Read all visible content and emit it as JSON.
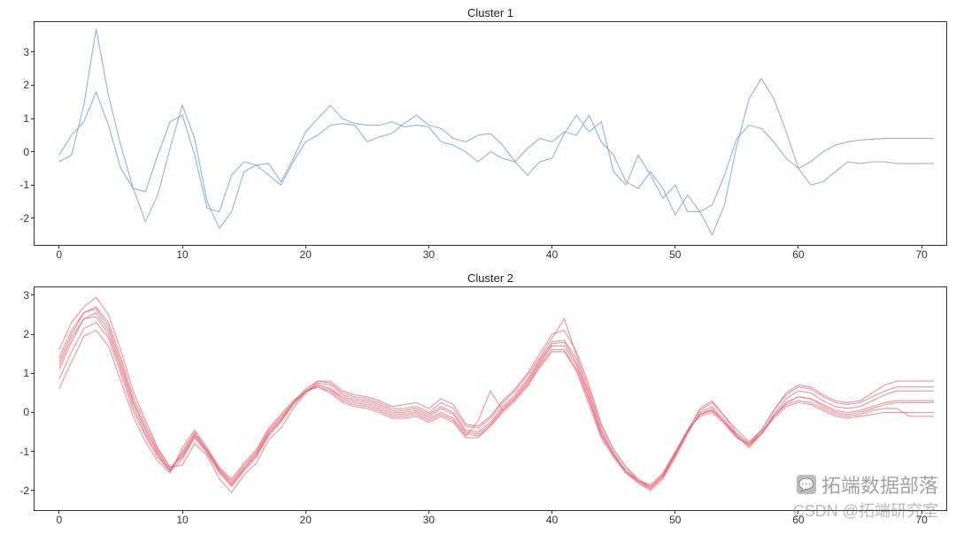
{
  "watermarks": {
    "line1_icon": "💬",
    "line1_text": "拓端数据部落",
    "line2": "CSDN @拓端研究室"
  },
  "chart_data": [
    {
      "type": "line",
      "title": "Cluster 1",
      "xlabel": "",
      "ylabel": "",
      "xlim": [
        -2,
        72
      ],
      "ylim": [
        -2.8,
        3.9
      ],
      "xticks": [
        0,
        10,
        20,
        30,
        40,
        50,
        60,
        70
      ],
      "yticks": [
        -2,
        -1,
        0,
        1,
        2,
        3
      ],
      "color": "#7aa6e0",
      "alpha": 0.85,
      "series": [
        {
          "name": "c1-a",
          "values": [
            -0.3,
            -0.1,
            1.4,
            3.7,
            1.7,
            0.2,
            -1.1,
            -2.1,
            -1.3,
            0.1,
            1.4,
            0.4,
            -1.5,
            -2.3,
            -1.8,
            -0.6,
            -0.4,
            -0.35,
            -0.9,
            -0.2,
            0.6,
            1.0,
            1.4,
            1.0,
            0.85,
            0.8,
            0.8,
            0.9,
            0.75,
            0.8,
            0.75,
            0.3,
            0.2,
            0.0,
            -0.3,
            0.0,
            -0.2,
            -0.3,
            -0.7,
            -0.3,
            -0.2,
            0.55,
            1.1,
            0.6,
            0.9,
            -0.6,
            -1.0,
            -0.1,
            -0.7,
            -1.4,
            -1.0,
            -1.8,
            -1.8,
            -2.5,
            -1.6,
            0.2,
            1.6,
            2.2,
            1.6,
            0.6,
            -0.5,
            -1.0,
            -0.9,
            -0.6,
            -0.3,
            -0.35,
            -0.3,
            -0.3,
            -0.35,
            -0.35,
            -0.35,
            -0.35
          ]
        },
        {
          "name": "c1-b",
          "values": [
            -0.1,
            0.5,
            0.9,
            1.8,
            0.8,
            -0.5,
            -1.1,
            -1.2,
            -0.1,
            0.9,
            1.1,
            -0.1,
            -1.7,
            -1.8,
            -0.7,
            -0.3,
            -0.4,
            -0.7,
            -1.0,
            -0.3,
            0.3,
            0.5,
            0.8,
            0.85,
            0.8,
            0.3,
            0.45,
            0.55,
            0.85,
            1.1,
            0.8,
            0.7,
            0.4,
            0.3,
            0.5,
            0.55,
            0.2,
            -0.3,
            0.1,
            0.4,
            0.3,
            0.6,
            0.5,
            1.1,
            0.3,
            -0.1,
            -0.9,
            -1.1,
            -0.6,
            -1.1,
            -1.9,
            -1.3,
            -1.8,
            -1.6,
            -0.7,
            0.4,
            0.8,
            0.7,
            0.3,
            -0.2,
            -0.5,
            -0.3,
            0.0,
            0.2,
            0.3,
            0.35,
            0.38,
            0.4,
            0.4,
            0.4,
            0.4,
            0.4
          ]
        }
      ]
    },
    {
      "type": "line",
      "title": "Cluster 2",
      "xlabel": "",
      "ylabel": "",
      "xlim": [
        -2,
        72
      ],
      "ylim": [
        -2.5,
        3.2
      ],
      "xticks": [
        0,
        10,
        20,
        30,
        40,
        50,
        60,
        70
      ],
      "yticks": [
        -2,
        -1,
        0,
        1,
        2,
        3
      ],
      "color": "#e66b76",
      "alpha": 0.72,
      "series": [
        {
          "name": "c2-a",
          "values": [
            1.6,
            2.3,
            2.7,
            2.95,
            2.5,
            1.6,
            0.55,
            -0.2,
            -0.9,
            -1.4,
            -1.35,
            -0.8,
            -1.1,
            -1.7,
            -2.05,
            -1.6,
            -1.3,
            -0.7,
            -0.4,
            0.1,
            0.5,
            0.8,
            0.8,
            0.55,
            0.45,
            0.4,
            0.3,
            0.15,
            0.2,
            0.25,
            0.1,
            0.35,
            0.2,
            -0.3,
            -0.35,
            -0.1,
            0.3,
            0.6,
            1.0,
            1.5,
            2.0,
            2.1,
            1.55,
            0.7,
            -0.3,
            -0.95,
            -1.4,
            -1.75,
            -1.95,
            -1.65,
            -1.1,
            -0.5,
            0.1,
            0.3,
            -0.1,
            -0.55,
            -0.8,
            -0.45,
            0.05,
            0.5,
            0.7,
            0.65,
            0.45,
            0.3,
            0.25,
            0.3,
            0.5,
            0.7,
            0.8,
            0.8,
            0.8,
            0.8
          ]
        },
        {
          "name": "c2-b",
          "values": [
            1.3,
            2.0,
            2.55,
            2.65,
            2.2,
            1.3,
            0.3,
            -0.4,
            -1.0,
            -1.5,
            -1.2,
            -0.65,
            -1.05,
            -1.55,
            -1.9,
            -1.5,
            -1.15,
            -0.6,
            -0.25,
            0.2,
            0.55,
            0.75,
            0.7,
            0.45,
            0.35,
            0.3,
            0.2,
            0.05,
            0.05,
            0.1,
            -0.05,
            0.15,
            0.0,
            -0.45,
            -0.5,
            -0.25,
            0.15,
            0.45,
            0.85,
            1.35,
            1.8,
            1.85,
            1.35,
            0.5,
            -0.45,
            -1.05,
            -1.5,
            -1.8,
            -2.0,
            -1.7,
            -1.15,
            -0.55,
            0.0,
            0.15,
            -0.2,
            -0.6,
            -0.9,
            -0.55,
            -0.05,
            0.35,
            0.55,
            0.5,
            0.3,
            0.15,
            0.1,
            0.15,
            0.3,
            0.45,
            0.55,
            0.55,
            0.55,
            0.55
          ]
        },
        {
          "name": "c2-c",
          "values": [
            1.1,
            1.8,
            2.4,
            2.45,
            2.0,
            1.1,
            0.15,
            -0.55,
            -1.1,
            -1.5,
            -1.05,
            -0.55,
            -0.95,
            -1.45,
            -1.8,
            -1.4,
            -1.05,
            -0.5,
            -0.15,
            0.25,
            0.55,
            0.7,
            0.6,
            0.35,
            0.25,
            0.2,
            0.1,
            -0.05,
            -0.05,
            0.0,
            -0.15,
            0.0,
            -0.15,
            -0.55,
            -0.6,
            -0.35,
            0.05,
            0.35,
            0.75,
            1.25,
            1.7,
            1.7,
            1.2,
            0.35,
            -0.55,
            -1.1,
            -1.55,
            -1.8,
            -1.95,
            -1.65,
            -1.1,
            -0.5,
            -0.05,
            0.05,
            -0.25,
            -0.65,
            -0.85,
            -0.55,
            -0.1,
            0.25,
            0.4,
            0.35,
            0.15,
            0.0,
            -0.05,
            0.0,
            0.1,
            0.2,
            0.25,
            0.25,
            0.25,
            0.25
          ]
        },
        {
          "name": "c2-d",
          "values": [
            0.6,
            1.3,
            1.95,
            2.1,
            1.7,
            0.8,
            -0.1,
            -0.75,
            -1.25,
            -1.55,
            -0.9,
            -0.45,
            -0.9,
            -1.4,
            -1.7,
            -1.3,
            -0.95,
            -0.4,
            -0.05,
            0.3,
            0.55,
            0.65,
            0.5,
            0.25,
            0.15,
            0.1,
            0.0,
            -0.15,
            -0.15,
            -0.1,
            -0.25,
            -0.1,
            -0.25,
            -0.65,
            -0.65,
            -0.35,
            0.0,
            0.3,
            0.65,
            1.15,
            1.55,
            1.55,
            1.05,
            0.2,
            -0.65,
            -1.15,
            -1.55,
            -1.75,
            -1.85,
            -1.55,
            -1.0,
            -0.45,
            -0.1,
            0.0,
            -0.3,
            -0.65,
            -0.8,
            -0.55,
            -0.15,
            0.15,
            0.25,
            0.2,
            0.05,
            -0.1,
            -0.15,
            -0.1,
            -0.05,
            0.0,
            0.0,
            0.0,
            0.0,
            0.0
          ]
        },
        {
          "name": "c2-e",
          "values": [
            1.4,
            2.1,
            2.55,
            2.7,
            2.3,
            1.4,
            0.4,
            -0.3,
            -0.95,
            -1.4,
            -1.15,
            -0.6,
            -1.0,
            -1.5,
            -1.85,
            -1.45,
            -1.1,
            -0.55,
            -0.2,
            0.25,
            0.6,
            0.8,
            0.75,
            0.5,
            0.4,
            0.35,
            0.25,
            0.1,
            0.1,
            0.15,
            0.0,
            0.25,
            0.1,
            -0.35,
            -0.4,
            -0.15,
            0.25,
            0.55,
            0.95,
            1.4,
            1.9,
            2.4,
            1.45,
            0.6,
            -0.35,
            -0.95,
            -1.4,
            -1.7,
            -1.9,
            -1.6,
            -1.05,
            -0.45,
            0.05,
            0.25,
            -0.1,
            -0.45,
            -0.75,
            -0.45,
            0.05,
            0.45,
            0.65,
            0.6,
            0.4,
            0.25,
            0.2,
            0.25,
            0.4,
            0.55,
            0.65,
            0.65,
            0.65,
            0.65
          ]
        },
        {
          "name": "c2-f",
          "values": [
            1.2,
            1.9,
            2.4,
            2.55,
            2.1,
            1.2,
            0.25,
            -0.45,
            -1.05,
            -1.45,
            -1.1,
            -0.6,
            -1.0,
            -1.5,
            -1.85,
            -1.45,
            -1.1,
            -0.55,
            -0.2,
            0.2,
            0.5,
            0.7,
            0.6,
            0.4,
            0.3,
            0.25,
            0.15,
            0.0,
            0.0,
            0.05,
            -0.1,
            0.1,
            -0.05,
            -0.5,
            -0.55,
            -0.3,
            0.1,
            0.4,
            0.8,
            1.3,
            1.75,
            1.8,
            1.25,
            0.45,
            -0.5,
            -1.05,
            -1.5,
            -1.75,
            -1.9,
            -1.6,
            -1.05,
            -0.5,
            -0.05,
            0.1,
            -0.25,
            -0.6,
            -0.85,
            -0.55,
            -0.1,
            0.25,
            0.4,
            0.35,
            0.2,
            0.05,
            0.0,
            0.05,
            0.15,
            0.25,
            0.3,
            0.3,
            0.3,
            0.3
          ]
        },
        {
          "name": "c2-g",
          "values": [
            0.85,
            1.55,
            2.15,
            2.3,
            1.9,
            1.0,
            0.05,
            -0.6,
            -1.15,
            -1.5,
            -1.0,
            -0.5,
            -0.95,
            -1.45,
            -1.75,
            -1.35,
            -1.0,
            -0.45,
            -0.1,
            0.25,
            0.55,
            0.65,
            0.55,
            0.3,
            0.2,
            0.15,
            0.05,
            -0.1,
            -0.1,
            -0.05,
            -0.2,
            -0.05,
            -0.2,
            -0.6,
            -0.22,
            0.55,
            0.05,
            0.35,
            0.7,
            1.2,
            1.6,
            1.6,
            1.1,
            0.3,
            -0.6,
            -1.1,
            -1.5,
            -1.75,
            -1.9,
            -1.6,
            -1.05,
            -0.5,
            -0.05,
            0.05,
            -0.25,
            -0.55,
            -0.8,
            -0.5,
            -0.1,
            0.2,
            0.3,
            0.25,
            0.1,
            -0.05,
            -0.1,
            -0.05,
            0.05,
            0.1,
            0.1,
            -0.1,
            -0.1,
            -0.1
          ]
        }
      ]
    }
  ]
}
